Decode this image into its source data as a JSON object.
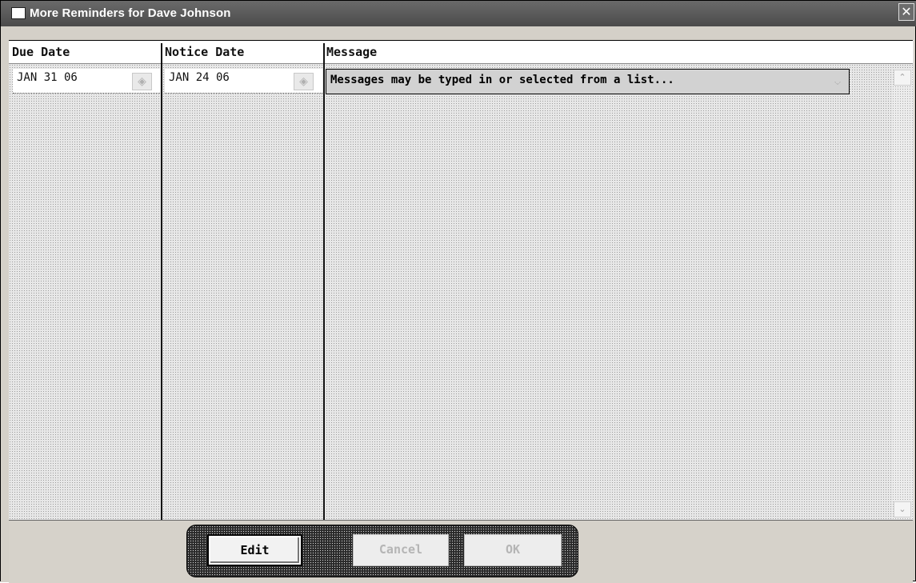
{
  "window": {
    "title": "More Reminders for Dave Johnson",
    "close_glyph": "✕"
  },
  "table": {
    "columns": [
      "Due Date",
      "Notice Date",
      "Message"
    ],
    "rows": [
      {
        "due_date": "JAN 31 06",
        "notice_date": "JAN 24 06",
        "message": "Messages may be typed in or selected from a list..."
      }
    ]
  },
  "icons": {
    "calendar": "calendar-icon",
    "dropdown": "chevron-down-icon",
    "scroll_up": "chevron-up-icon",
    "scroll_down": "chevron-down-icon",
    "calendar_glyph": "◈",
    "dropdown_glyph": "⌵",
    "scroll_up_glyph": "⌃",
    "scroll_down_glyph": "⌄"
  },
  "buttons": {
    "edit": "Edit",
    "cancel": "Cancel",
    "ok": "OK"
  }
}
